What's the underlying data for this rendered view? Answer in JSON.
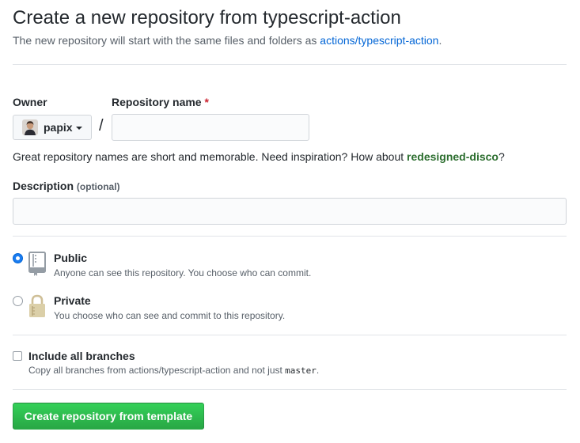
{
  "header": {
    "title": "Create a new repository from typescript-action",
    "subtitle_prefix": "The new repository will start with the same files and folders as ",
    "template_link": "actions/typescript-action",
    "subtitle_suffix": "."
  },
  "form": {
    "owner_label": "Owner",
    "owner_value": "papix",
    "separator": "/",
    "repo_name_label": "Repository name",
    "required_marker": "*",
    "repo_name_value": "",
    "hint_text": "Great repository names are short and memorable. Need inspiration? How about ",
    "hint_suggestion": "redesigned-disco",
    "hint_end": "?",
    "description_label": "Description",
    "description_optional": "(optional)",
    "description_value": ""
  },
  "visibility": {
    "public": {
      "label": "Public",
      "note": "Anyone can see this repository. You choose who can commit.",
      "selected": true,
      "icon": "repo-book-icon"
    },
    "private": {
      "label": "Private",
      "note": "You choose who can see and commit to this repository.",
      "selected": false,
      "icon": "lock-icon"
    }
  },
  "branches": {
    "label": "Include all branches",
    "note_prefix": "Copy all branches from actions/typescript-action and not just ",
    "note_code": "master",
    "note_suffix": ".",
    "checked": false
  },
  "submit_label": "Create repository from template",
  "colors": {
    "accent_link": "#0366d6",
    "primary_button": "#28a745",
    "required": "#cb2431",
    "suggestion": "#2c6e2f"
  }
}
